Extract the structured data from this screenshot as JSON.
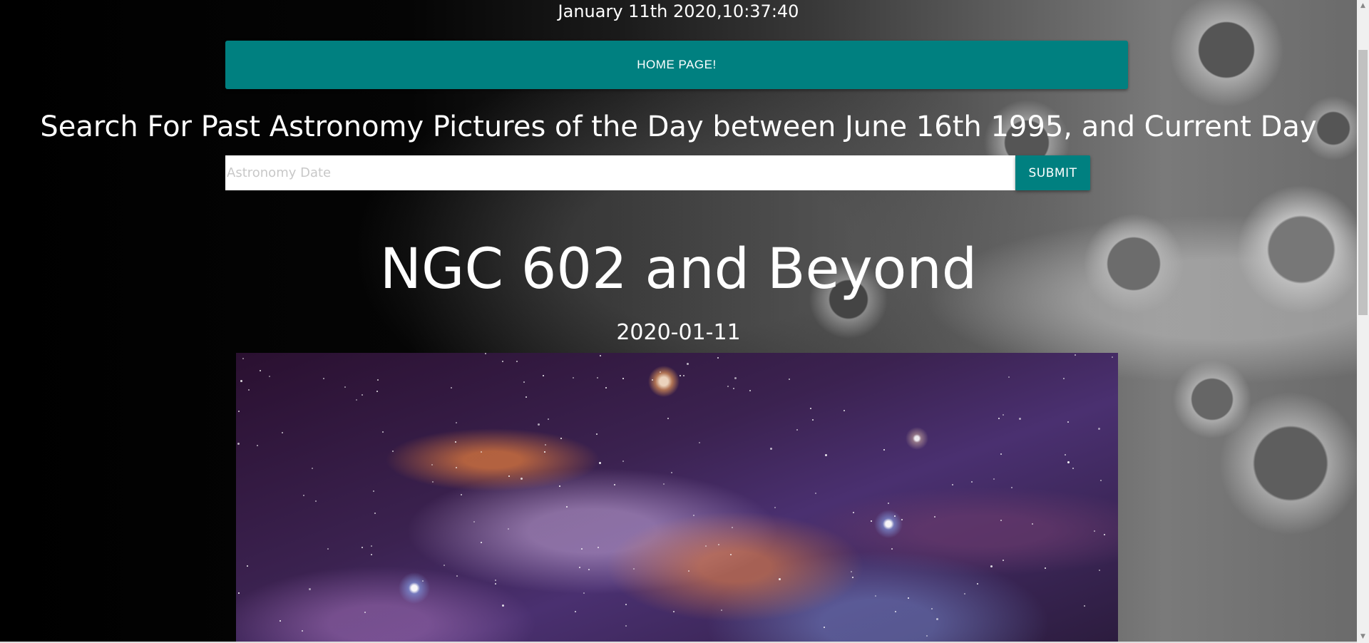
{
  "header": {
    "clock_text": "January 11th 2020,10:37:40"
  },
  "nav": {
    "home_label": "HOME PAGE!"
  },
  "search": {
    "heading": "Search For Past Astronomy Pictures of the Day between June 16th 1995, and Current Day",
    "input_value": "",
    "input_placeholder": "Astronomy Date",
    "submit_label": "SUBMIT"
  },
  "apod": {
    "title": "NGC 602 and Beyond",
    "date": "2020-01-11"
  },
  "colors": {
    "accent": "#008080",
    "background": "#000000",
    "text": "#ffffff"
  }
}
